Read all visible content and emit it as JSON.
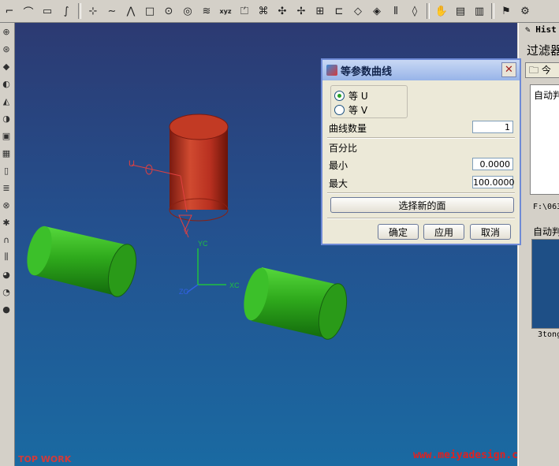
{
  "toolbar": {
    "icons": [
      "corner-icon",
      "arc-icon",
      "sketch-icon",
      "spline-icon",
      "point-icon",
      "curve-icon",
      "polyline-icon",
      "rectangle-icon",
      "circle-icon",
      "circle2-icon",
      "helix-icon",
      "xyz-icon",
      "extrude-icon",
      "offset-icon",
      "bridge-icon",
      "blend-icon",
      "project-icon",
      "trim-icon",
      "mirror-icon",
      "join-icon",
      "iso-icon",
      "smart-icon",
      "hand-icon",
      "layer-icon",
      "stack-icon",
      "flag-icon",
      "analyze-icon",
      "pencil-icon"
    ],
    "labels": {
      "xyz-icon": "xyz"
    }
  },
  "left_toolbar": {
    "icons": [
      "sphere-icon",
      "globe-icon",
      "cube-icon",
      "torus-icon",
      "cone-icon",
      "shell-icon",
      "frame-icon",
      "grid-icon",
      "book-icon",
      "layers-icon",
      "bucket-icon",
      "gear-icon",
      "arch-icon",
      "column-icon",
      "paint-icon",
      "fill-icon",
      "drop-icon"
    ]
  },
  "viewport": {
    "axis_labels": {
      "u": "U",
      "v": "V",
      "yc": "YC",
      "xc": "XC",
      "zc": "ZC"
    },
    "watermark_left": "TOP WORK",
    "watermark_right": "www.meiyadesign.com",
    "colors": {
      "cylinder_red": "#b83020",
      "cylinder_green": "#2faa1c",
      "axis_green": "#20c040",
      "axis_blue": "#3060e0"
    }
  },
  "dialog": {
    "title": "等参数曲线",
    "close": "✕",
    "radio_u": "等 U",
    "radio_v": "等 V",
    "selected": "u",
    "curve_count_label": "曲线数量",
    "curve_count_value": "1",
    "percent_label": "百分比",
    "min_label": "最小",
    "min_value": "0.0000",
    "max_label": "最大",
    "max_value": "100.0000",
    "select_face_button": "选择新的面",
    "ok_button": "确定",
    "apply_button": "应用",
    "cancel_button": "取消"
  },
  "right_panel": {
    "title": "Hist",
    "filter": "过滤器",
    "tab": "今",
    "auto_label_1": "自动判",
    "path": "F:\\063",
    "auto_label_2": "自动判",
    "file": "3tong"
  }
}
